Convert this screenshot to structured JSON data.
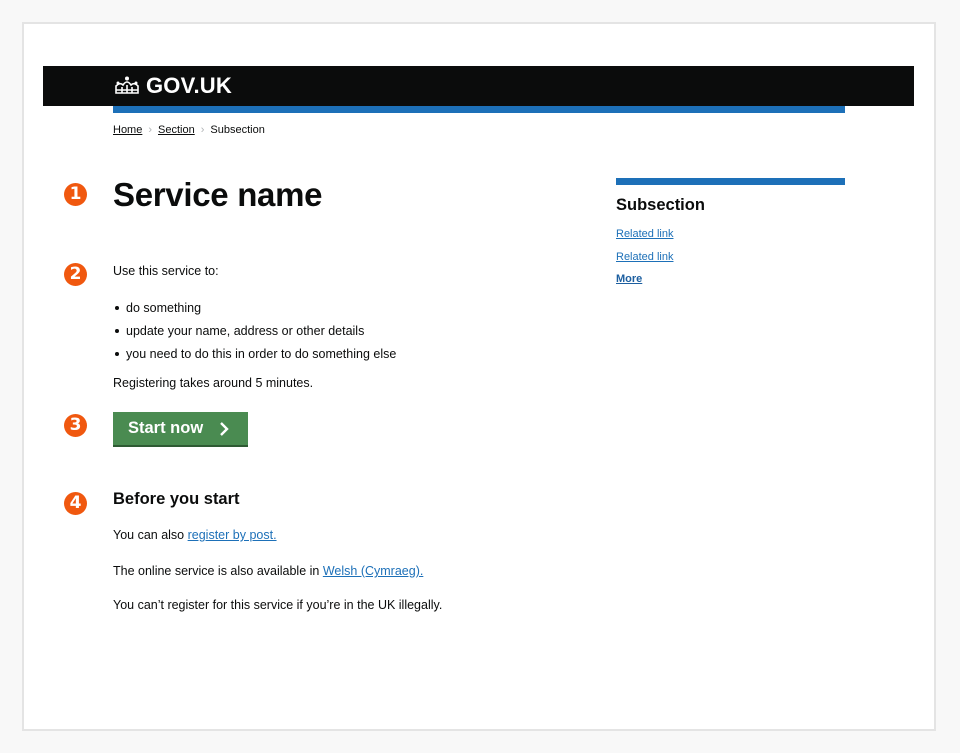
{
  "header": {
    "logo_text": "GOV.UK",
    "logo_icon": "crown-icon"
  },
  "colors": {
    "header_bg": "#0b0c0c",
    "accent_blue": "#1d70b8",
    "button_green": "#4a8b51",
    "badge_orange": "#f0580f",
    "link": "#1d70b8"
  },
  "breadcrumb": {
    "items": [
      {
        "label": "Home",
        "link": true
      },
      {
        "label": "Section",
        "link": true
      },
      {
        "label": "Subsection",
        "link": false
      }
    ],
    "separator_icon": "chevron-right-icon"
  },
  "annotations": [
    "1",
    "2",
    "3",
    "4"
  ],
  "main": {
    "title": "Service name",
    "intro": "Use this service to:",
    "bullets": [
      "do something",
      "update your name, address or other details",
      "you need to do this in order to do something else"
    ],
    "duration": "Registering takes around 5 minutes.",
    "start_button": {
      "label": "Start now",
      "icon": "chevron-right-icon"
    },
    "before_heading": "Before you start",
    "paragraphs": [
      {
        "text": "You can also ",
        "link": "register by post."
      },
      {
        "text": "The online service is also available in ",
        "link": "Welsh (Cymraeg)."
      },
      {
        "text": "You can’t register for this service if you’re in the UK illegally.",
        "link": null
      }
    ]
  },
  "sidebar": {
    "title": "Subsection",
    "links": [
      "Related link",
      "Related link",
      "More"
    ]
  }
}
